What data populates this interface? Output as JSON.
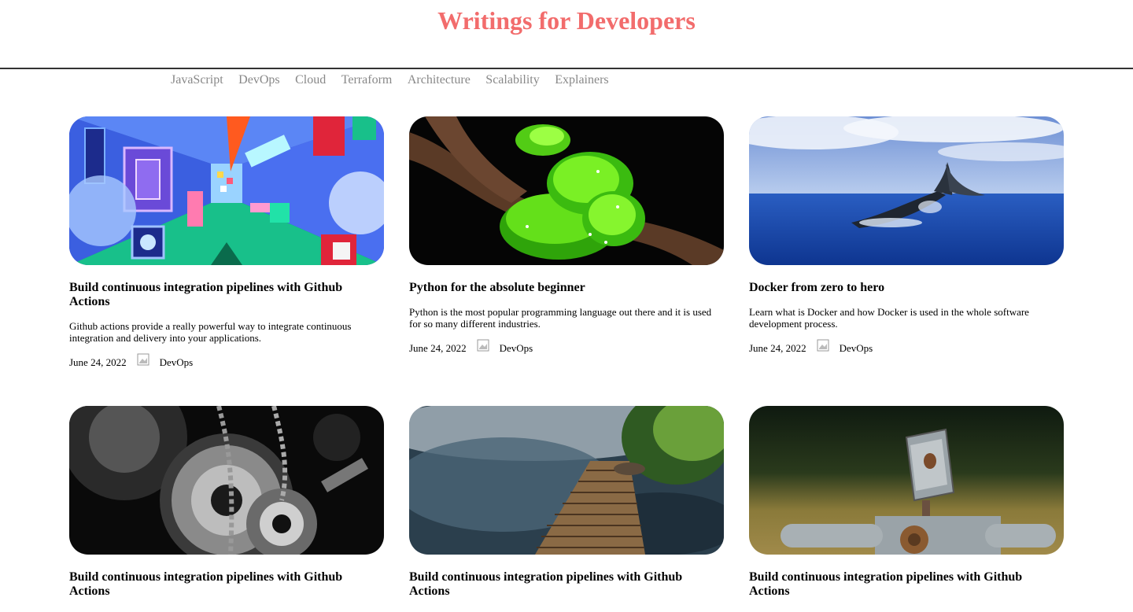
{
  "site": {
    "title": "Writings for Developers"
  },
  "nav": {
    "items": [
      "JavaScript",
      "DevOps",
      "Cloud",
      "Terraform",
      "Architecture",
      "Scalability",
      "Explainers"
    ]
  },
  "posts": [
    {
      "title": "Build continuous integration pipelines with Github Actions",
      "excerpt": "Github actions provide a really powerful way to integrate continuous integration and delivery into your applications.",
      "date": "June 24, 2022",
      "category": "DevOps",
      "image": "colorful-corridor-illustration"
    },
    {
      "title": "Python for the absolute beginner",
      "excerpt": "Python is the most popular programming language out there and it is used for so many different industries.",
      "date": "June 24, 2022",
      "category": "DevOps",
      "image": "green-snake-on-branch"
    },
    {
      "title": "Docker from zero to hero",
      "excerpt": "Learn what is Docker and how Docker is used in the whole software development process.",
      "date": "June 24, 2022",
      "category": "DevOps",
      "image": "whale-tail-ocean"
    },
    {
      "title": "Build continuous integration pipelines with Github Actions",
      "image": "black-white-gears"
    },
    {
      "title": "Build continuous integration pipelines with Github Actions",
      "image": "wooden-path-over-water"
    },
    {
      "title": "Build continuous integration pipelines with Github Actions",
      "image": "rusty-robot-toy"
    }
  ],
  "colors": {
    "title": "#f26c6c",
    "nav": "#888888",
    "header_rule": "#333333"
  }
}
